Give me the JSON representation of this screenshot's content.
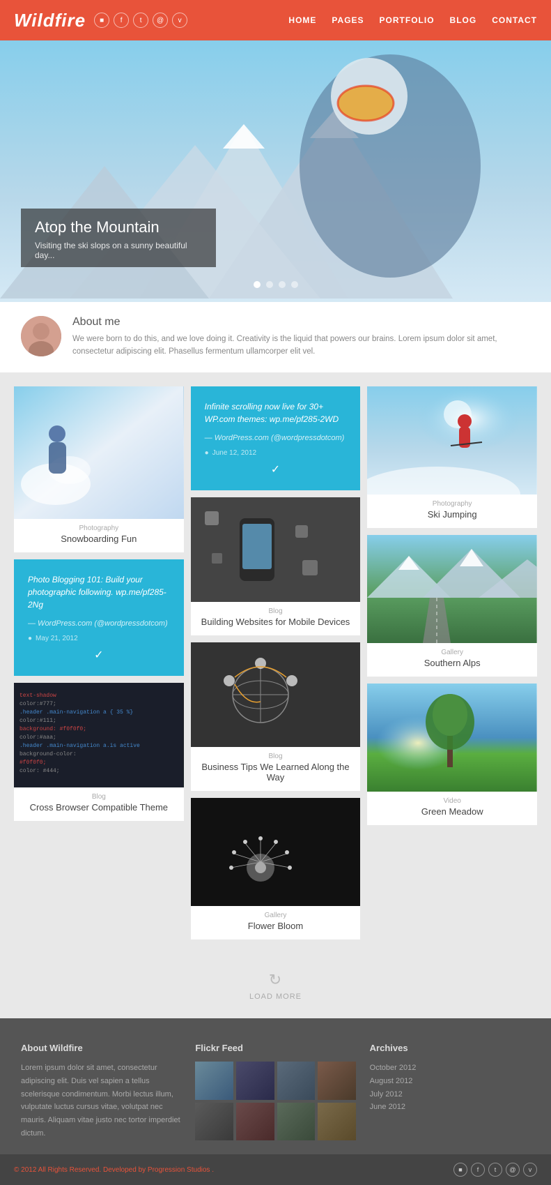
{
  "header": {
    "logo": "Wildfire",
    "nav": [
      "HOME",
      "PAGES",
      "PORTFOLIO",
      "BLOG",
      "CONTACT"
    ]
  },
  "hero": {
    "title": "Atop the Mountain",
    "subtitle": "Visiting the ski slops on a sunny beautiful day...",
    "dots": 4,
    "active_dot": 1
  },
  "about": {
    "heading": "About me",
    "text": "We were born to do this, and we love doing it. Creativity is the liquid that powers our brains. Lorem ipsum dolor sit amet, consectetur adipiscing elit. Phasellus fermentum ullamcorper elit vel."
  },
  "grid": {
    "col1": [
      {
        "type": "photo",
        "label": "Photography",
        "title": "Snowboarding Fun"
      },
      {
        "type": "twitter",
        "text": "Photo Blogging 101: Build your photographic following. wp.me/pf285-2Ng",
        "author": "— WordPress.com (@wordpressdotcom)",
        "date": "May 21, 2012"
      },
      {
        "type": "photo",
        "label": "Blog",
        "title": "Cross Browser Compatible Theme"
      }
    ],
    "col2": [
      {
        "type": "twitter",
        "text": "Infinite scrolling now live for 30+ WP.com themes: wp.me/pf285-2WD",
        "author": "— WordPress.com (@wordpressdotcom)",
        "date": "June 12, 2012"
      },
      {
        "type": "photo",
        "label": "Blog",
        "title": "Building Websites for Mobile Devices"
      },
      {
        "type": "photo",
        "label": "Blog",
        "title": "Business Tips We Learned Along the Way"
      },
      {
        "type": "photo",
        "label": "Gallery",
        "title": "Flower Bloom"
      }
    ],
    "col3": [
      {
        "type": "photo",
        "label": "Photography",
        "title": "Ski Jumping"
      },
      {
        "type": "photo",
        "label": "Gallery",
        "title": "Southern Alps"
      },
      {
        "type": "photo",
        "label": "Video",
        "title": "Green Meadow"
      }
    ]
  },
  "load_more": "LOAD MORE",
  "footer": {
    "about": {
      "heading": "About Wildfire",
      "text": "Lorem ipsum dolor sit amet, consectetur adipiscing elit. Duis vel sapien a tellus scelerisque condimentum. Morbi lectus illum, vulputate luctus cursus vitae, volutpat nec mauris. Aliquam vitae justo nec tortor imperdiet dictum."
    },
    "flickr": {
      "heading": "Flickr Feed",
      "thumbs": 8
    },
    "archives": {
      "heading": "Archives",
      "items": [
        "October 2012",
        "August 2012",
        "July 2012",
        "June 2012"
      ]
    }
  },
  "bottom": {
    "copyright": "© 2012 All Rights Reserved. Developed by",
    "author": "Progression Studios",
    "period": "."
  }
}
